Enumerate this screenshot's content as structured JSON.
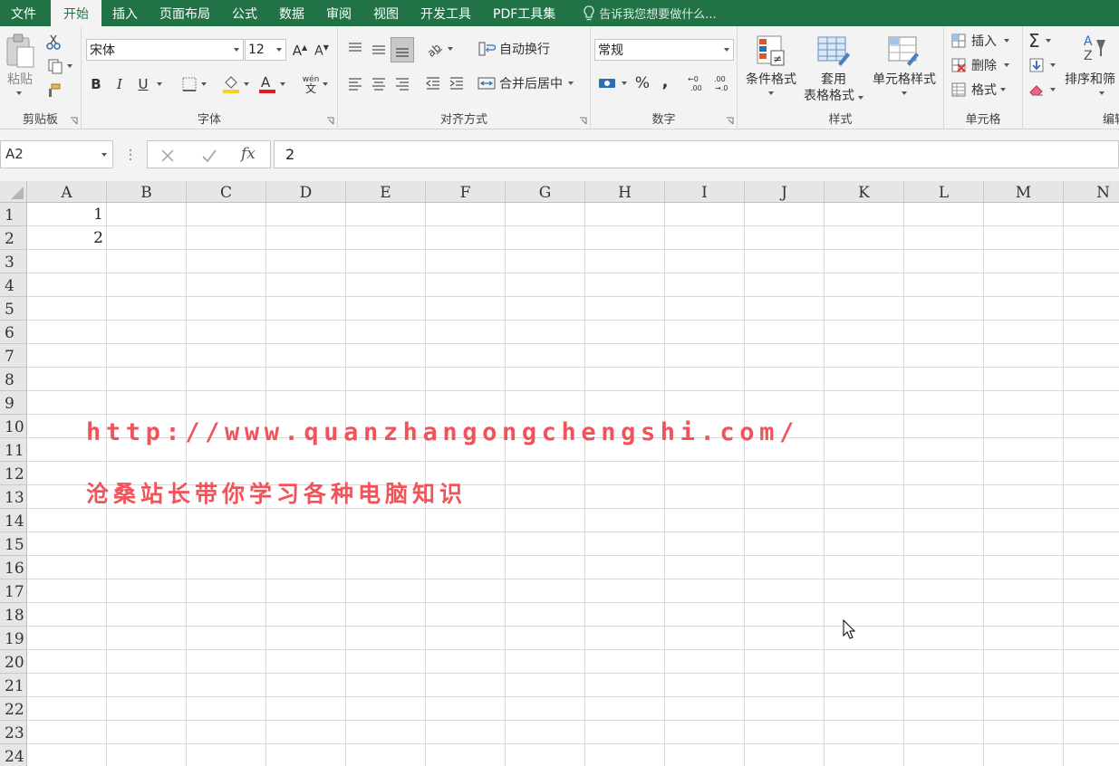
{
  "menu": {
    "tabs": [
      "文件",
      "开始",
      "插入",
      "页面布局",
      "公式",
      "数据",
      "审阅",
      "视图",
      "开发工具",
      "PDF工具集"
    ],
    "active": "开始",
    "tell_me": "告诉我您想要做什么..."
  },
  "ribbon": {
    "clipboard": {
      "label": "剪贴板",
      "paste": "粘贴"
    },
    "font": {
      "label": "字体",
      "name": "宋体",
      "size": "12",
      "bold": "B",
      "italic": "I",
      "underline": "U",
      "phonetic_top": "wén",
      "phonetic_bottom": "文"
    },
    "alignment": {
      "label": "对齐方式",
      "wrap": "自动换行",
      "merge": "合并后居中"
    },
    "number": {
      "label": "数字",
      "format": "常规",
      "percent": "%",
      "comma": ","
    },
    "styles": {
      "label": "样式",
      "conditional": "条件格式",
      "table_line1": "套用",
      "table_line2": "表格格式",
      "cell_styles": "单元格样式"
    },
    "cells": {
      "label": "单元格",
      "insert": "插入",
      "delete": "删除",
      "format": "格式"
    },
    "editing": {
      "label": "编辑",
      "sort": "排序和筛"
    }
  },
  "formula_bar": {
    "name_box": "A2",
    "fx": "fx",
    "value": "2"
  },
  "sheet": {
    "columns": [
      "A",
      "B",
      "C",
      "D",
      "E",
      "F",
      "G",
      "H",
      "I",
      "J",
      "K",
      "L",
      "M",
      "N"
    ],
    "rows": [
      "1",
      "2",
      "3",
      "4",
      "5",
      "6",
      "7",
      "8",
      "9",
      "10",
      "11",
      "12",
      "13",
      "14",
      "15",
      "16",
      "17",
      "18",
      "19",
      "20",
      "21",
      "22",
      "23",
      "24"
    ],
    "cells": {
      "A1": "1",
      "A2": "2"
    }
  },
  "watermark": {
    "url": "http://www.quanzhangongchengshi.com/",
    "slogan": "沧桑站长带你学习各种电脑知识",
    "color": "#f0545a"
  },
  "colors": {
    "brand": "#217346",
    "ribbon_bg": "#f3f3f3",
    "header_bg": "#e6e6e6"
  }
}
